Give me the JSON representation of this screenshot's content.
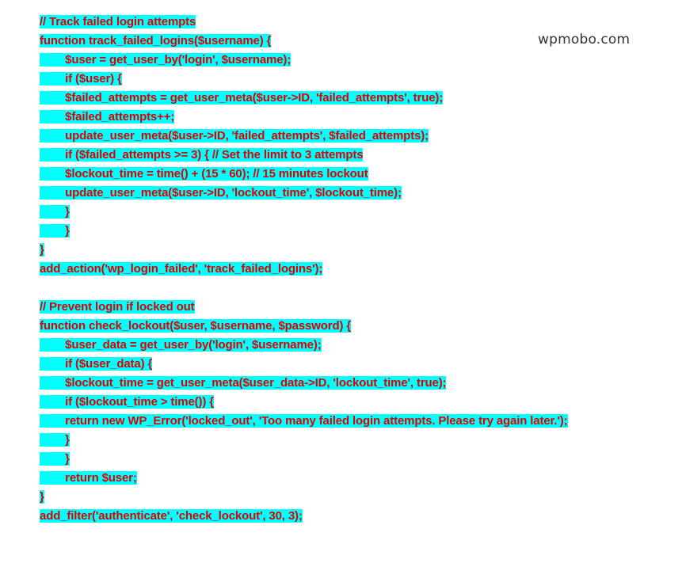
{
  "page": {
    "background_color": "#ffffff",
    "highlight_color": "#00ffff",
    "text_color": "#e00000"
  },
  "watermark": {
    "text": "wpmobo.com",
    "color": "#333333"
  },
  "code": {
    "language": "php",
    "lines": [
      {
        "indent": 0,
        "text": "// Track failed login attempts",
        "highlighted": true
      },
      {
        "indent": 0,
        "text": "function track_failed_logins($username) {",
        "highlighted": true
      },
      {
        "indent": 1,
        "text": "$user = get_user_by('login', $username);",
        "highlighted": true
      },
      {
        "indent": 1,
        "text": "if ($user) {",
        "highlighted": true
      },
      {
        "indent": 1,
        "text": "$failed_attempts = get_user_meta($user->ID, 'failed_attempts', true);",
        "highlighted": true
      },
      {
        "indent": 1,
        "text": "$failed_attempts++;",
        "highlighted": true
      },
      {
        "indent": 1,
        "text": "update_user_meta($user->ID, 'failed_attempts', $failed_attempts);",
        "highlighted": true
      },
      {
        "indent": 1,
        "text": "if ($failed_attempts >= 3) { // Set the limit to 3 attempts",
        "highlighted": true
      },
      {
        "indent": 1,
        "text": "$lockout_time = time() + (15 * 60); // 15 minutes lockout",
        "highlighted": true
      },
      {
        "indent": 1,
        "text": "update_user_meta($user->ID, 'lockout_time', $lockout_time);",
        "highlighted": true
      },
      {
        "indent": 1,
        "text": "}",
        "highlighted": true
      },
      {
        "indent": 1,
        "text": "}",
        "highlighted": true
      },
      {
        "indent": 0,
        "text": "}",
        "highlighted": true
      },
      {
        "indent": 0,
        "text": "add_action('wp_login_failed', 'track_failed_logins');",
        "highlighted": true
      },
      {
        "indent": 0,
        "text": "",
        "highlighted": false
      },
      {
        "indent": 0,
        "text": "// Prevent login if locked out",
        "highlighted": true
      },
      {
        "indent": 0,
        "text": "function check_lockout($user, $username, $password) {",
        "highlighted": true
      },
      {
        "indent": 1,
        "text": "$user_data = get_user_by('login', $username);",
        "highlighted": true
      },
      {
        "indent": 1,
        "text": "if ($user_data) {",
        "highlighted": true
      },
      {
        "indent": 1,
        "text": "$lockout_time = get_user_meta($user_data->ID, 'lockout_time', true);",
        "highlighted": true
      },
      {
        "indent": 1,
        "text": "if ($lockout_time > time()) {",
        "highlighted": true
      },
      {
        "indent": 1,
        "text": "return new WP_Error('locked_out', 'Too many failed login attempts. Please try again later.');",
        "highlighted": true
      },
      {
        "indent": 1,
        "text": "}",
        "highlighted": true
      },
      {
        "indent": 1,
        "text": "}",
        "highlighted": true
      },
      {
        "indent": 1,
        "text": "return $user;",
        "highlighted": true
      },
      {
        "indent": 0,
        "text": "}",
        "highlighted": true
      },
      {
        "indent": 0,
        "text": "add_filter('authenticate', 'check_lockout', 30, 3);",
        "highlighted": true
      }
    ]
  }
}
